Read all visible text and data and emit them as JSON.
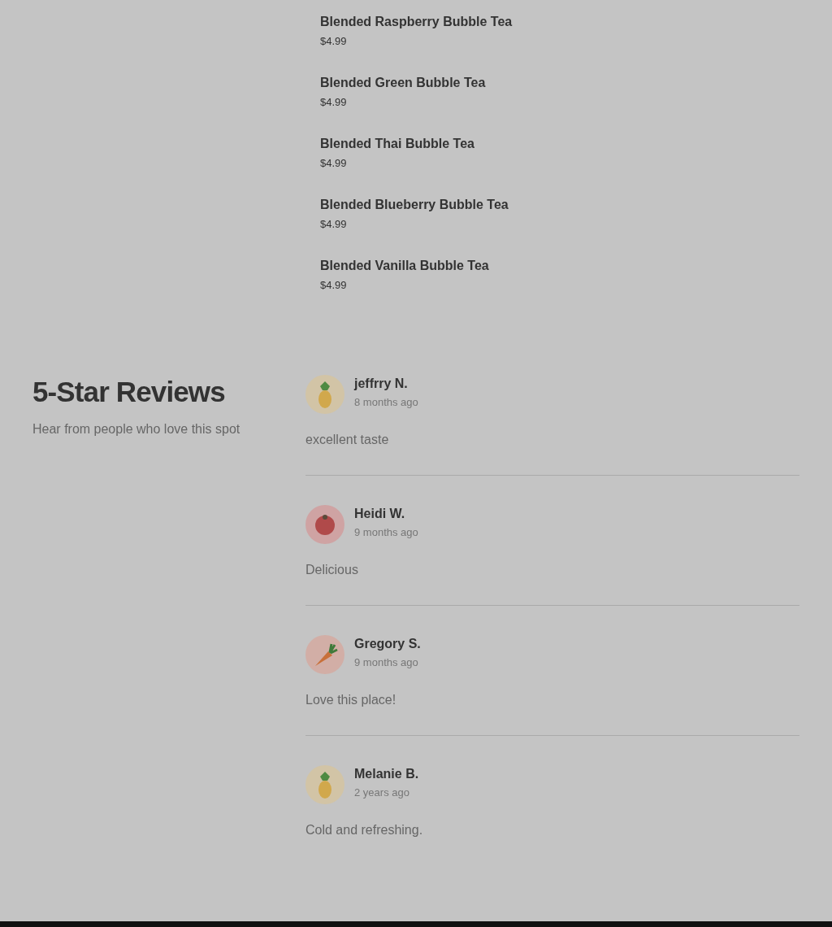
{
  "menu_items": [
    {
      "name": "Blended Raspberry Bubble Tea",
      "price": "$4.99"
    },
    {
      "name": "Blended Green Bubble Tea",
      "price": "$4.99"
    },
    {
      "name": "Blended Thai Bubble Tea",
      "price": "$4.99"
    },
    {
      "name": "Blended Blueberry Bubble Tea",
      "price": "$4.99"
    },
    {
      "name": "Blended Vanilla Bubble Tea",
      "price": "$4.99"
    }
  ],
  "reviews_section": {
    "title": "5-Star Reviews",
    "subtitle": "Hear from people who love this spot"
  },
  "reviews": [
    {
      "kind": "pineapple",
      "name": "jeffrry N.",
      "time": "8 months ago",
      "text": "excellent taste"
    },
    {
      "kind": "tomato",
      "name": "Heidi W.",
      "time": "9 months ago",
      "text": "Delicious"
    },
    {
      "kind": "carrot",
      "name": "Gregory S.",
      "time": "9 months ago",
      "text": "Love this place!"
    },
    {
      "kind": "pineapple",
      "name": "Melanie B.",
      "time": "2 years ago",
      "text": "Cold and refreshing."
    }
  ]
}
